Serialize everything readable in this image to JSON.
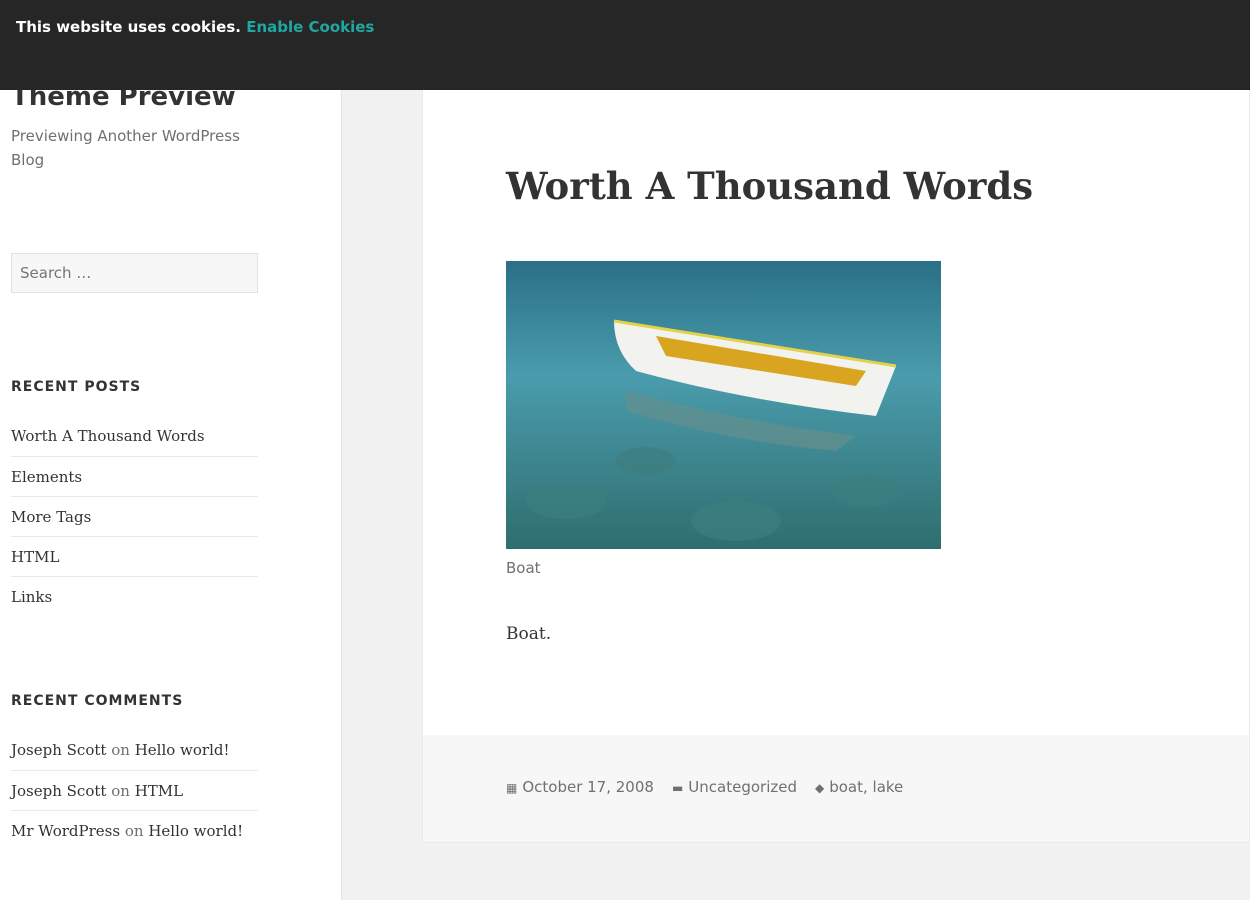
{
  "banner": {
    "text": "This website uses cookies.",
    "link": "Enable Cookies",
    "link_color": "#1fa8a3"
  },
  "site": {
    "title": "Theme Preview",
    "description": "Previewing Another WordPress Blog"
  },
  "search": {
    "placeholder": "Search …"
  },
  "recent_posts": {
    "title": "RECENT POSTS",
    "items": [
      "Worth A Thousand Words",
      "Elements",
      "More Tags",
      "HTML",
      "Links"
    ]
  },
  "recent_comments": {
    "title": "RECENT COMMENTS",
    "items": [
      {
        "author": "Joseph Scott",
        "on": "on",
        "post": "Hello world!"
      },
      {
        "author": "Joseph Scott",
        "on": "on",
        "post": "HTML"
      },
      {
        "author": "Mr WordPress",
        "on": "on",
        "post": "Hello world!"
      }
    ]
  },
  "post": {
    "title": "Worth A Thousand Words",
    "caption": "Boat",
    "body": "Boat.",
    "date": "October 17, 2008",
    "category": "Uncategorized",
    "tags": "boat, lake",
    "icons": {
      "date": "calendar-icon",
      "category": "folder-icon",
      "tags": "tag-icon"
    }
  }
}
